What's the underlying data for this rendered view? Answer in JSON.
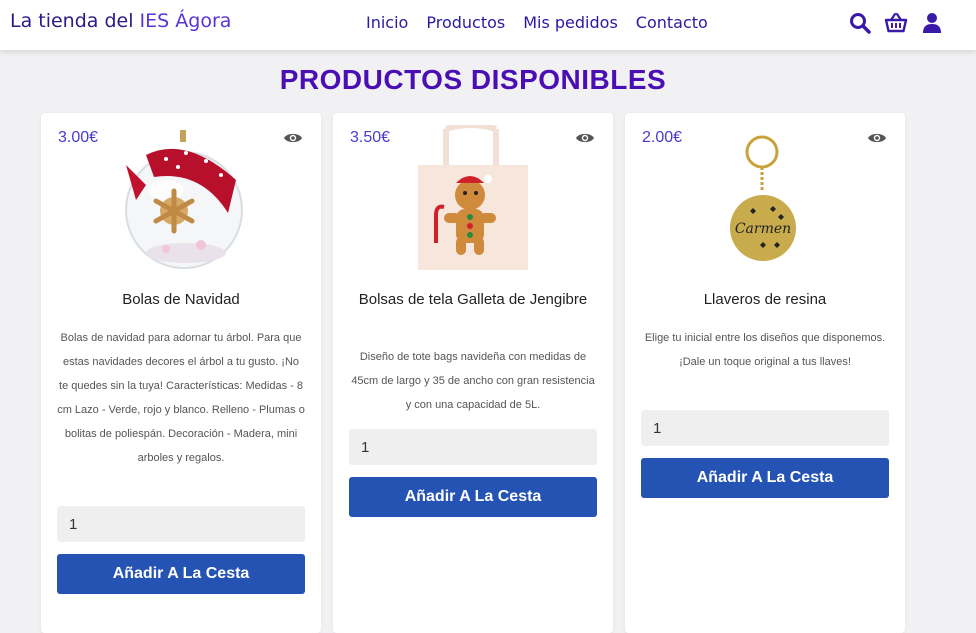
{
  "header": {
    "brand_main": "La tienda del ",
    "brand_accent": "IES Ágora",
    "nav": [
      "Inicio",
      "Productos",
      "Mis pedidos",
      "Contacto"
    ],
    "icons": [
      "search-icon",
      "basket-icon",
      "user-icon"
    ]
  },
  "page": {
    "title": "PRODUCTOS DISPONIBLES"
  },
  "products": [
    {
      "price": "3.00€",
      "name": "Bolas de Navidad",
      "description": "Bolas de navidad para adornar tu árbol. Para que estas navidades decores el árbol a tu gusto. ¡No te quedes sin la tuya! Características: Medidas - 8 cm Lazo - Verde, rojo y blanco. Relleno - Plumas o bolitas de poliespán. Decoración - Madera, mini arboles y regalos.",
      "quantity": "1",
      "button": "Añadir A La Cesta"
    },
    {
      "price": "3.50€",
      "name": "Bolsas de tela Galleta de Jengibre",
      "description": "Diseño de tote bags navideña con medidas de 45cm de largo y 35 de ancho con gran resistencia y con una capacidad de 5L.",
      "quantity": "1",
      "button": "Añadir A La Cesta"
    },
    {
      "price": "2.00€",
      "name": "Llaveros de resina",
      "description": "Elige tu inicial entre los diseños que disponemos. ¡Dale un toque original a tus llaves!",
      "quantity": "1",
      "button": "Añadir A La Cesta",
      "keychain_text": "Carmen"
    }
  ],
  "colors": {
    "accent": "#4a0fb4",
    "button": "#2553b4",
    "nav": "#2a1aa0"
  }
}
